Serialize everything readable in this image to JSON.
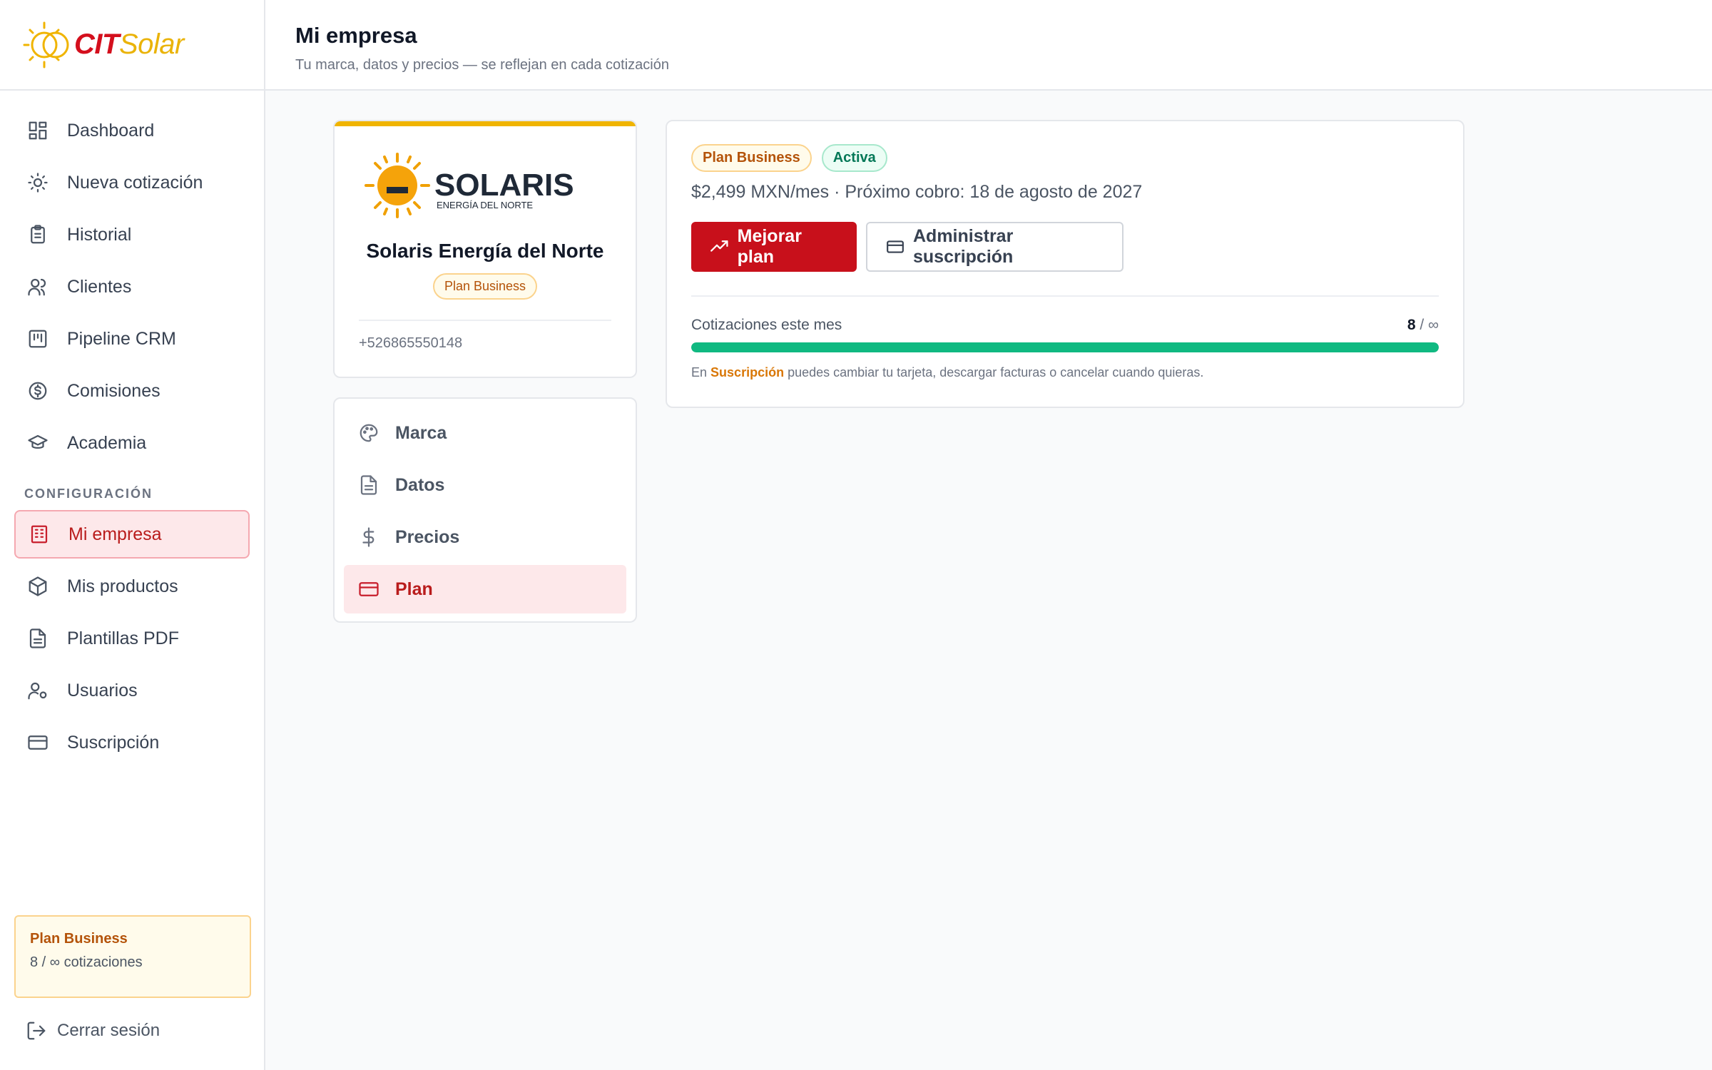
{
  "brand": {
    "cit": "CIT",
    "solar": "Solar"
  },
  "sidebar": {
    "items": [
      {
        "label": "Dashboard",
        "icon": "dashboard-icon"
      },
      {
        "label": "Nueva cotización",
        "icon": "sun-icon"
      },
      {
        "label": "Historial",
        "icon": "clipboard-icon"
      },
      {
        "label": "Clientes",
        "icon": "users-icon"
      },
      {
        "label": "Pipeline CRM",
        "icon": "kanban-icon"
      },
      {
        "label": "Comisiones",
        "icon": "dollar-circle-icon"
      },
      {
        "label": "Academia",
        "icon": "graduation-cap-icon"
      }
    ],
    "section_label": "CONFIGURACIÓN",
    "config_items": [
      {
        "label": "Mi empresa",
        "icon": "building-icon",
        "active": true
      },
      {
        "label": "Mis productos",
        "icon": "package-icon"
      },
      {
        "label": "Plantillas PDF",
        "icon": "file-text-icon"
      },
      {
        "label": "Usuarios",
        "icon": "user-cog-icon"
      },
      {
        "label": "Suscripción",
        "icon": "credit-card-icon"
      }
    ],
    "plan_box": {
      "title": "Plan Business",
      "usage": "8 / ∞ cotizaciones"
    },
    "logout_label": "Cerrar sesión"
  },
  "header": {
    "title": "Mi empresa",
    "subtitle": "Tu marca, datos y precios — se reflejan en cada cotización"
  },
  "company": {
    "logo_word": "SOLARIS",
    "logo_tagline": "ENERGÍA DEL NORTE",
    "name": "Solaris Energía del Norte",
    "plan_pill": "Plan Business",
    "phone": "+526865550148"
  },
  "company_menu": {
    "items": [
      {
        "label": "Marca",
        "icon": "palette-icon"
      },
      {
        "label": "Datos",
        "icon": "document-icon"
      },
      {
        "label": "Precios",
        "icon": "dollar-icon"
      },
      {
        "label": "Plan",
        "icon": "card-icon",
        "active": true
      }
    ]
  },
  "plan": {
    "badge_plan": "Plan Business",
    "badge_status": "Activa",
    "price_line": "$2,499 MXN/mes · Próximo cobro: 18 de agosto de 2027",
    "upgrade_label": "Mejorar plan",
    "manage_label": "Administrar suscripción",
    "usage_label": "Cotizaciones este mes",
    "usage_count": "8",
    "usage_limit": "/ ∞",
    "usage_fraction": 1.0,
    "note_prefix": "En",
    "note_link": "Suscripción",
    "note_suffix": "puedes cambiar tu tarjeta, descargar facturas o cancelar cuando quieras."
  },
  "colors": {
    "brand_red": "#c8101b",
    "brand_yellow": "#eab308",
    "success": "#10b981",
    "warning": "#b45309"
  }
}
